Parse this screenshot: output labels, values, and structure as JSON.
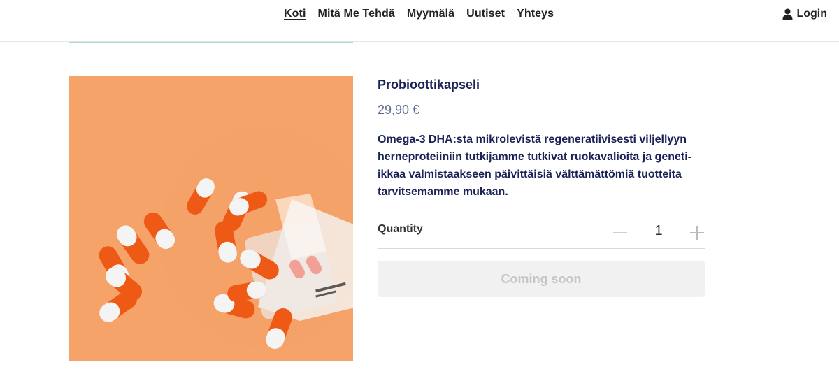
{
  "nav": {
    "links": [
      {
        "label": "Koti",
        "active": true
      },
      {
        "label": "Mitä Me Tehdä"
      },
      {
        "label": "Myymälä"
      },
      {
        "label": "Uutiset"
      },
      {
        "label": "Yhteys"
      }
    ],
    "login_label": "Login",
    "login_icon": "user-icon"
  },
  "product": {
    "image_icon": "capsules-photo",
    "title": "Probioottikapseli",
    "price": "29,90 €",
    "description": "Omega-3 DHA:sta mikrolevistä regeneratiivisesti viljellyyn herneproteiiniin tutkijamme tutkivat ruokavalioita ja geneti-ikkaa valmistaakseen päivittäisiä välttämättömiä tuotteita tarvitsemamme mukaan.",
    "quantity_label": "Quantity",
    "quantity_value": "1",
    "minus_icon": "minus-icon",
    "plus_icon": "plus-icon",
    "button_label": "Coming soon"
  },
  "colors": {
    "accent": "#1b2257",
    "price": "#5d6b8c",
    "image_bg": "#f6a36a",
    "pill_orange": "#ee5a16",
    "pill_white": "#f4f4f4"
  }
}
